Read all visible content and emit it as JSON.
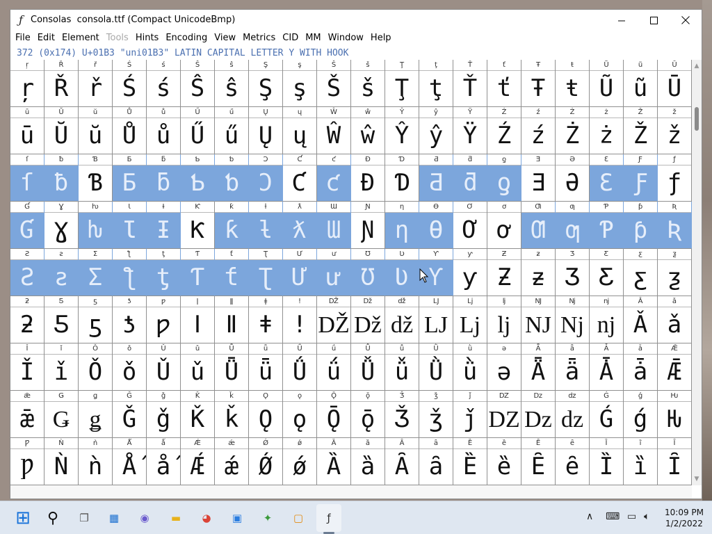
{
  "window": {
    "title": "Consolas  consola.ttf (Compact UnicodeBmp)",
    "minimize_glyph": "—",
    "maximize_glyph": "□",
    "close_glyph": "✕"
  },
  "menu": [
    {
      "label": "File",
      "enabled": true
    },
    {
      "label": "Edit",
      "enabled": true
    },
    {
      "label": "Element",
      "enabled": true
    },
    {
      "label": "Tools",
      "enabled": false
    },
    {
      "label": "Hints",
      "enabled": true
    },
    {
      "label": "Encoding",
      "enabled": true
    },
    {
      "label": "View",
      "enabled": true
    },
    {
      "label": "Metrics",
      "enabled": true
    },
    {
      "label": "CID",
      "enabled": true
    },
    {
      "label": "MM",
      "enabled": true
    },
    {
      "label": "Window",
      "enabled": true
    },
    {
      "label": "Help",
      "enabled": true
    }
  ],
  "info": "372 (0x174) U+01B3 \"uni01B3\" LATIN CAPITAL LETTER Y WITH HOOK",
  "glyph_rows": [
    {
      "chars": "ŗŘřŚśŜŝŞşŠšŢţŤťŦŧŨũŪ",
      "selected_from": -1,
      "selected_to": -1
    },
    {
      "chars": "ūŬŭŮůŰűŲųŴŵŶŷŸŹźŻżŽž",
      "selected_from": -1,
      "selected_to": -1
    },
    {
      "chars": "ſƀƁƂƃƄƅƆƇƈƉƊƋƌƍƎƏƐƑƒ",
      "selected_from": 0,
      "selected_to": 19
    },
    {
      "chars": "ƓƔƕƖƗƘƙƚƛƜƝƞƟƠơƢƣƤƥƦ",
      "selected_from": 0,
      "selected_to": 19
    },
    {
      "chars": "ƧƨƩƪƫƬƭƮƯưƱƲƳƴƵƶƷƸƹƺ",
      "selected_from": 0,
      "selected_to": 12
    },
    {
      "chars": "ƻƼƽƾƿǀǁǂǃǄǅǆǇǈǉǊǋǌǍǎ",
      "selected_from": -1,
      "selected_to": -1
    },
    {
      "chars": "ǏǐǑǒǓǔǕǖǗǘǙǚǛǜǝǞǟǠǡǢ",
      "selected_from": -1,
      "selected_to": -1
    },
    {
      "chars": "ǣǤǥǦǧǨǩǪǫǬǭǮǯǰǱǲǳǴǵǶ",
      "selected_from": -1,
      "selected_to": -1
    },
    {
      "chars": "ǷǸǹǺǻǼǽǾǿȀȁȂȃȄȅȆȇȈȉȊ",
      "selected_from": -1,
      "selected_to": -1
    }
  ],
  "selected_cells_partial": [
    {
      "row": 2,
      "col": 2,
      "selected": false
    },
    {
      "row": 2,
      "col": 6,
      "selected": true
    },
    {
      "row": 2,
      "col": 7,
      "selected": true
    },
    {
      "row": 2,
      "col": 8,
      "selected": false
    },
    {
      "row": 2,
      "col": 10,
      "selected": false
    },
    {
      "row": 2,
      "col": 11,
      "selected": false
    },
    {
      "row": 2,
      "col": 15,
      "selected": false
    },
    {
      "row": 2,
      "col": 16,
      "selected": false
    },
    {
      "row": 2,
      "col": 19,
      "selected": false
    },
    {
      "row": 3,
      "col": 1,
      "selected": false
    },
    {
      "row": 3,
      "col": 5,
      "selected": false
    },
    {
      "row": 3,
      "col": 10,
      "selected": false
    },
    {
      "row": 3,
      "col": 13,
      "selected": false
    },
    {
      "row": 3,
      "col": 14,
      "selected": false
    }
  ],
  "taskbar": {
    "apps": [
      {
        "name": "start-icon",
        "glyph": "⊞",
        "color": "#1a73d9"
      },
      {
        "name": "search-icon",
        "glyph": "⚲",
        "color": "#111111"
      },
      {
        "name": "task-view-icon",
        "glyph": "❐",
        "color": "#555555"
      },
      {
        "name": "widgets-icon",
        "glyph": "▦",
        "color": "#1a6fd0"
      },
      {
        "name": "chat-icon",
        "glyph": "◉",
        "color": "#6a5acd"
      },
      {
        "name": "file-explorer-icon",
        "glyph": "▬",
        "color": "#e8b21c"
      },
      {
        "name": "chrome-icon",
        "glyph": "◕",
        "color": "#db4437"
      },
      {
        "name": "store-icon",
        "glyph": "▣",
        "color": "#2b7de0"
      },
      {
        "name": "app-icon-green",
        "glyph": "✦",
        "color": "#3a9a3a"
      },
      {
        "name": "app-icon-orange",
        "glyph": "▢",
        "color": "#e38b12"
      },
      {
        "name": "fontforge-icon",
        "glyph": "ƒ",
        "color": "#333333"
      }
    ],
    "tray": {
      "chevron": "∧",
      "keyboard": "⌨",
      "network": "▭",
      "volume": "🔈︎"
    },
    "time": "10:09 PM",
    "date": "1/2/2022"
  }
}
